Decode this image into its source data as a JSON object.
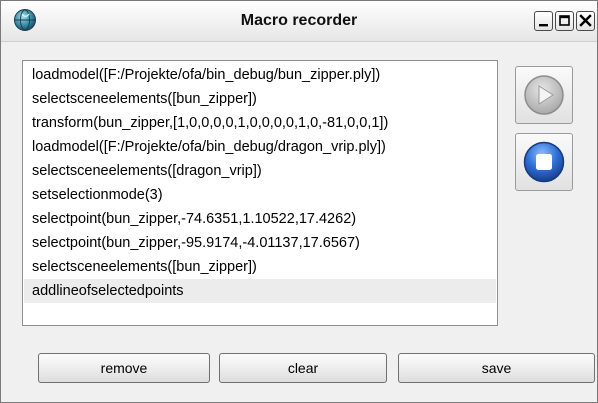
{
  "window": {
    "title": "Macro recorder"
  },
  "icons": {
    "app": "globe-icon",
    "minimize": "minimize-icon",
    "maximize": "maximize-icon",
    "close": "close-icon",
    "play": "play-icon",
    "stop": "stop-icon"
  },
  "macro_list": {
    "items": [
      "loadmodel([F:/Projekte/ofa/bin_debug/bun_zipper.ply])",
      "selectsceneelements([bun_zipper])",
      "transform(bun_zipper,[1,0,0,0,0,1,0,0,0,0,1,0,-81,0,0,1])",
      "loadmodel([F:/Projekte/ofa/bin_debug/dragon_vrip.ply])",
      "selectsceneelements([dragon_vrip])",
      "setselectionmode(3)",
      "selectpoint(bun_zipper,-74.6351,1.10522,17.4262)",
      "selectpoint(bun_zipper,-95.9174,-4.01137,17.6567)",
      "selectsceneelements([bun_zipper])",
      "addlineofselectedpoints"
    ],
    "selected_index": 9
  },
  "buttons": {
    "remove": "remove",
    "clear": "clear",
    "save": "save"
  },
  "colors": {
    "stop_accent": "#2f6fd6",
    "play_disabled": "#b8b8b8",
    "selection": "#ececec"
  }
}
